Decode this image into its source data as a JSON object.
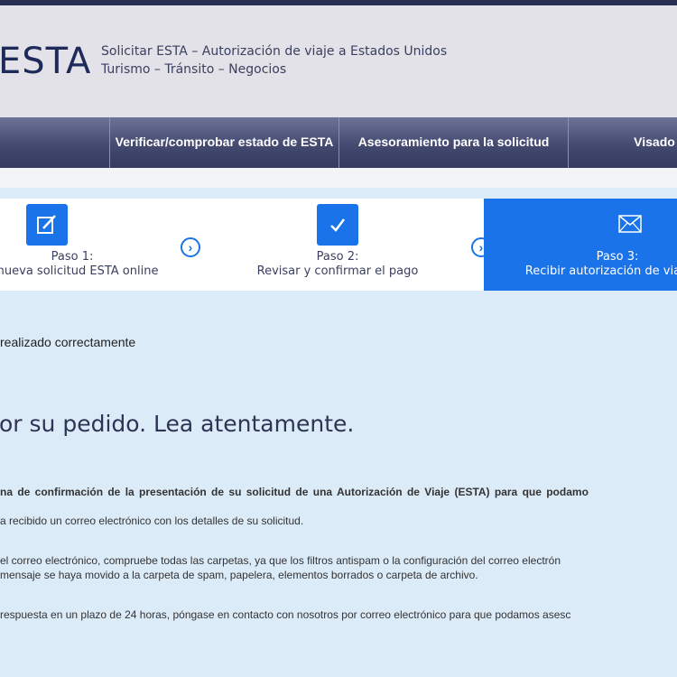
{
  "header": {
    "logo": "ESTA",
    "tagline_line1": "Solicitar ESTA – Autorización de viaje a Estados Unidos",
    "tagline_line2": "Turismo – Tránsito – Negocios"
  },
  "nav": {
    "items": [
      {
        "label": "Verificar/comprobar estado de ESTA"
      },
      {
        "label": "Asesoramiento para la solicitud"
      },
      {
        "label": "Visado"
      }
    ]
  },
  "steps": [
    {
      "step": "Paso 1:",
      "text": "a nueva solicitud ESTA online",
      "icon": "edit-icon"
    },
    {
      "step": "Paso 2:",
      "text": "Revisar y confirmar el pago",
      "icon": "check-icon"
    },
    {
      "step": "Paso 3:",
      "text": "Recibir autorización de viaje ES",
      "icon": "envelope-icon"
    }
  ],
  "content": {
    "success_text": "realizado correctamente",
    "heading": "or su pedido. Lea atentamente.",
    "para1": "na de confirmación de la presentación de su solicitud de una Autorización de Viaje (ESTA) para que podamo",
    "para2": "a recibido un correo electrónico con los detalles de su solicitud.",
    "para3_line1": "el correo electrónico, compruebe todas las carpetas, ya que los filtros antispam o la configuración del correo electrón",
    "para3_line2": "mensaje se haya movido a la carpeta de spam, papelera, elementos borrados o carpeta de archivo.",
    "para4": "respuesta en un plazo de 24 horas, póngase en contacto con nosotros por correo electrónico para que podamos asesc"
  },
  "colors": {
    "accent": "#1a73e8",
    "nav_bg": "#444a70",
    "page_bg": "#dcebf8"
  }
}
